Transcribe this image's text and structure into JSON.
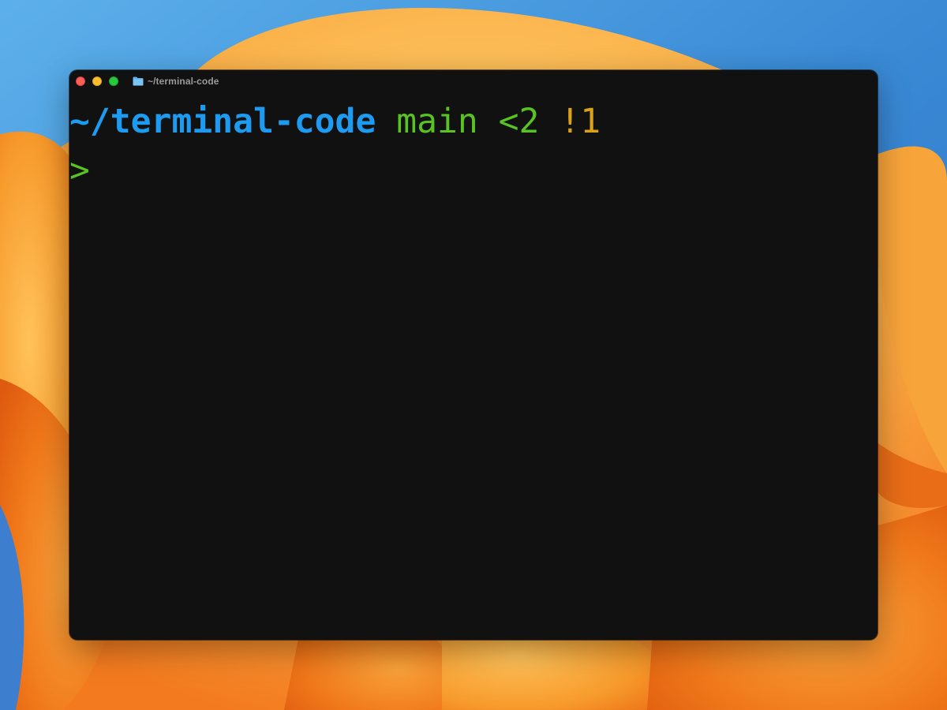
{
  "window": {
    "title": "~/terminal-code"
  },
  "colors": {
    "close": "#fe5f57",
    "minimize": "#febc2e",
    "zoom": "#28c840",
    "path": "#1d9bf0",
    "branch": "#58c322",
    "ahead": "#58c322",
    "modified": "#d9a21a",
    "prompt_symbol": "#58c322",
    "folder": "#61b4f2",
    "terminal_bg": "#111111"
  },
  "icons": {
    "close": "close-circle",
    "minimize": "minimize-circle",
    "zoom": "zoom-circle",
    "folder": "folder-icon"
  },
  "prompt": {
    "path_prefix": "~/",
    "path_dir": "terminal-code",
    "separator_1": " ",
    "branch": "main",
    "separator_2": " ",
    "ahead": "<2",
    "separator_3": " ",
    "modified": "!1",
    "input_symbol": ">"
  }
}
